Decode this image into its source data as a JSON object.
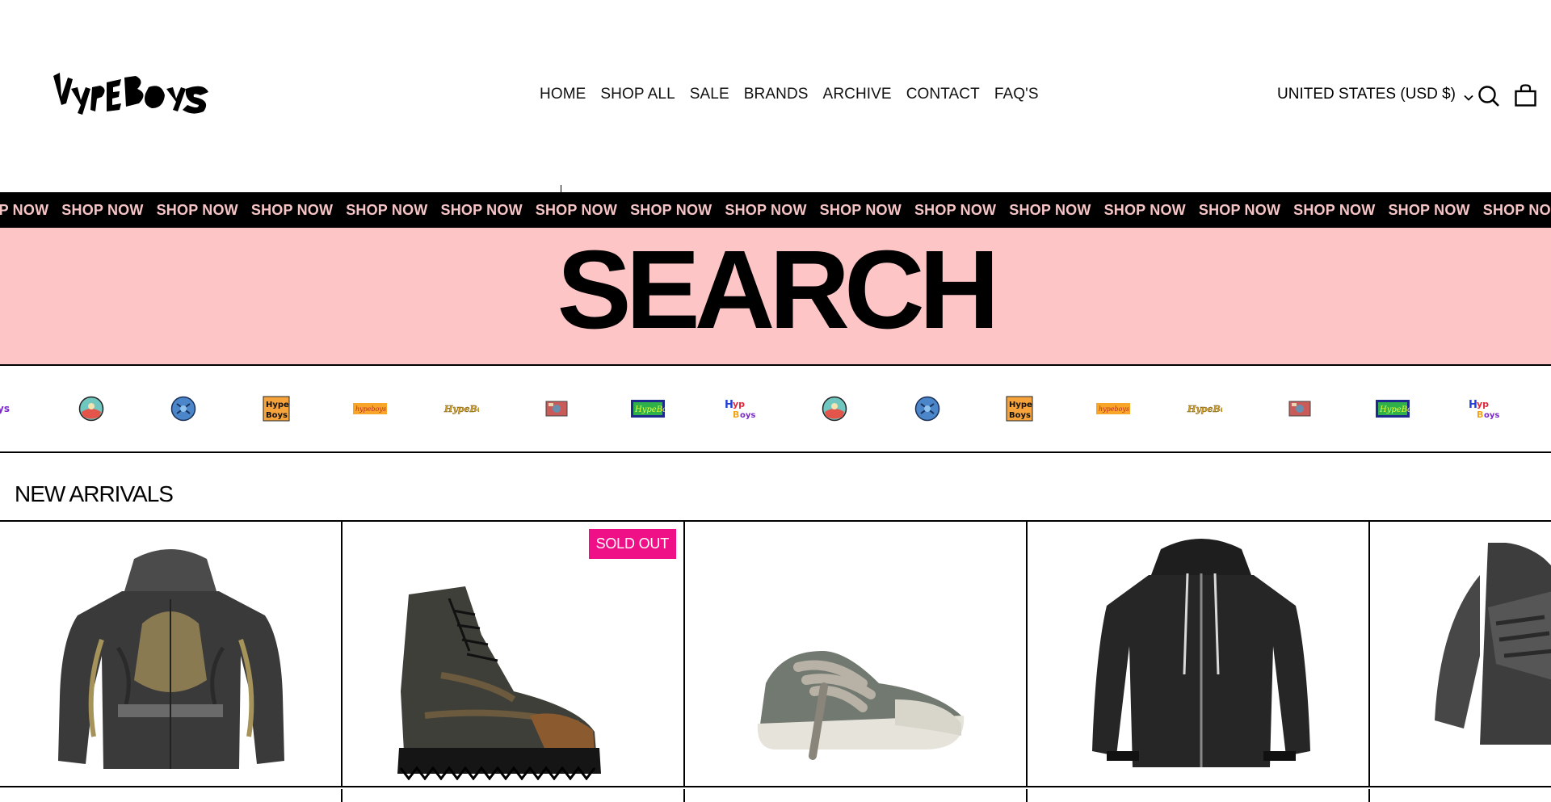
{
  "brand": {
    "logo_text": "HypeBoys"
  },
  "nav": {
    "items": [
      "HOME",
      "SHOP ALL",
      "SALE",
      "BRANDS",
      "ARCHIVE",
      "CONTACT",
      "FAQ'S"
    ]
  },
  "header": {
    "region_label": "UNITED STATES (USD $)",
    "search_icon": "search-icon",
    "cart_icon": "bag-icon"
  },
  "marquee": {
    "items": [
      "SHOP NOW",
      "SHOP NOW",
      "SHOP NOW",
      "SHOP NOW",
      "SHOP NOW",
      "SHOP NOW",
      "SHOP NOW",
      "SHOP NOW",
      "SHOP NOW",
      "SHOP NOW",
      "SHOP NOW",
      "SHOP NOW",
      "SHOP NOW",
      "SHOP NOW",
      "SHOP NOW",
      "SHOP NOW",
      "SHOP NOW"
    ]
  },
  "hero": {
    "title": "SEARCH"
  },
  "logo_strip": {
    "logos": [
      "circle-logo-teal",
      "circle-logo-blue",
      "hype-boys-square-logo",
      "hype-boys-orange-logo",
      "hype-boys-gold-logo",
      "photo-logo",
      "hype-boys-green-logo",
      "hype-boys-multicolor-logo",
      "circle-logo-teal",
      "circle-logo-blue",
      "hype-boys-square-logo",
      "hype-boys-orange-logo",
      "hype-boys-gold-logo",
      "photo-logo",
      "hype-boys-green-logo",
      "hype-boys-multicolor-logo"
    ]
  },
  "new_arrivals": {
    "title": "NEW ARRIVALS",
    "products": [
      {
        "image": "balenciaga-graphic-zip-hoodie",
        "badge": ""
      },
      {
        "image": "distressed-leather-combat-boot",
        "badge": "SOLD OUT"
      },
      {
        "image": "grey-low-top-sneaker-oversized-laces",
        "badge": ""
      },
      {
        "image": "black-zip-hoodie-white-drawstrings",
        "badge": ""
      },
      {
        "image": "washed-black-logo-hoodie",
        "badge": ""
      }
    ]
  },
  "colors": {
    "hero_bg": "#fdc5c6",
    "marquee_text": "#f7c5c6",
    "sold_out_badge": "#ef0f87"
  }
}
